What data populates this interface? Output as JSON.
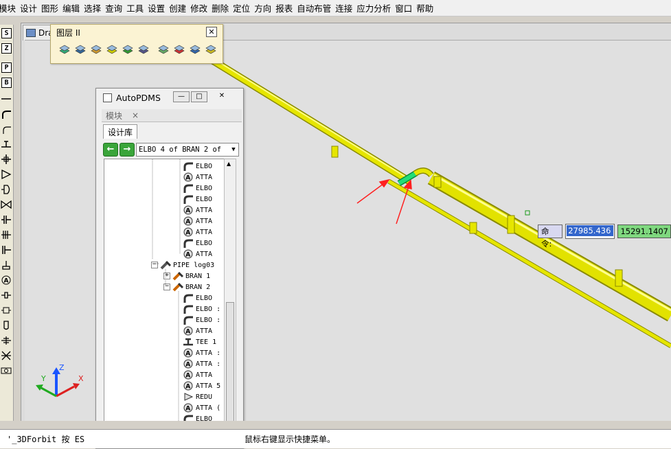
{
  "menu": [
    "模块",
    "设计",
    "图形",
    "编辑",
    "选择",
    "查询",
    "工具",
    "设置",
    "创建",
    "修改",
    "删除",
    "定位",
    "方向",
    "报表",
    "自动布管",
    "连接",
    "应力分析",
    "窗口",
    "帮助"
  ],
  "left_toolbar": {
    "s": "S",
    "z": "Z",
    "p": "P",
    "b": "B"
  },
  "doc_tab": "Dra",
  "layer_toolbar": {
    "title": "图层 II",
    "close": "✕"
  },
  "panel": {
    "title": "AutoPDMS",
    "module_tab": "模块",
    "module_close": "×",
    "library_tab": "设计库",
    "nav_left": "←",
    "nav_right": "→",
    "combo_value": "ELBO 4 of BRAN 2 of",
    "tree": [
      {
        "label": "ELBO",
        "icon": "elbow-icon"
      },
      {
        "label": "ATTA",
        "icon": "attachment-icon"
      },
      {
        "label": "ELBO",
        "icon": "elbow-icon"
      },
      {
        "label": "ELBO",
        "icon": "elbow-icon"
      },
      {
        "label": "ATTA",
        "icon": "attachment-icon"
      },
      {
        "label": "ATTA",
        "icon": "attachment-icon"
      },
      {
        "label": "ATTA",
        "icon": "attachment-icon"
      },
      {
        "label": "ELBO",
        "icon": "elbow-icon"
      },
      {
        "label": "ATTA",
        "icon": "attachment-icon"
      },
      {
        "label": "PIPE log03",
        "icon": "pipe-icon"
      },
      {
        "label": "BRAN 1",
        "icon": "branch-icon"
      },
      {
        "label": "BRAN 2",
        "icon": "branch-icon"
      },
      {
        "label": "ELBO",
        "icon": "elbow-icon"
      },
      {
        "label": "ELBO :",
        "icon": "elbow-icon"
      },
      {
        "label": "ELBO :",
        "icon": "elbow-icon"
      },
      {
        "label": "ATTA",
        "icon": "attachment-icon"
      },
      {
        "label": "TEE 1",
        "icon": "tee-icon"
      },
      {
        "label": "ATTA :",
        "icon": "attachment-icon"
      },
      {
        "label": "ATTA :",
        "icon": "attachment-icon"
      },
      {
        "label": "ATTA",
        "icon": "attachment-icon"
      },
      {
        "label": "ATTA 5",
        "icon": "attachment-icon"
      },
      {
        "label": "REDU",
        "icon": "reducer-icon"
      },
      {
        "label": "ATTA (",
        "icon": "attachment-icon"
      },
      {
        "label": "ELBO",
        "icon": "elbow-icon"
      }
    ]
  },
  "axes": {
    "x": "X",
    "y": "Y",
    "z": "Z"
  },
  "command": {
    "label": "命令:",
    "value1": "27985.436",
    "value2": "15291.1407"
  },
  "status": {
    "left": "'_3DForbit 按 ES",
    "right": "鼠标右键显示快捷菜单。"
  },
  "colors": {
    "pipe": "#e8e800",
    "highlight": "#22cc66",
    "arrow": "#ff2020"
  }
}
